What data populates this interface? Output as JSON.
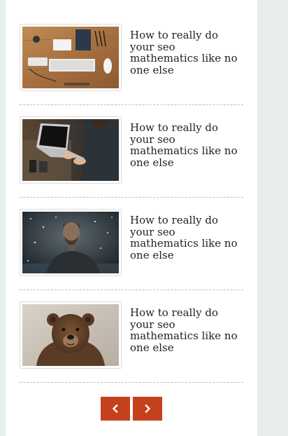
{
  "posts": [
    {
      "title": "How to really do your seo mathematics like no one else",
      "thumb": "desk-keyboard-photo"
    },
    {
      "title": "How to really do your seo mathematics like no one else",
      "thumb": "laptop-hands-photo"
    },
    {
      "title": "How to really do your seo mathematics like no one else",
      "thumb": "bearded-man-snow-photo"
    },
    {
      "title": "How to really do your seo mathematics like no one else",
      "thumb": "bear-photo"
    }
  ],
  "pagination": {
    "prev_icon": "chevron-left-icon",
    "next_icon": "chevron-right-icon"
  },
  "colors": {
    "accent": "#c5401c",
    "page_bg": "#e8eded",
    "panel_bg": "#ffffff",
    "divider": "#bdbdbd"
  }
}
